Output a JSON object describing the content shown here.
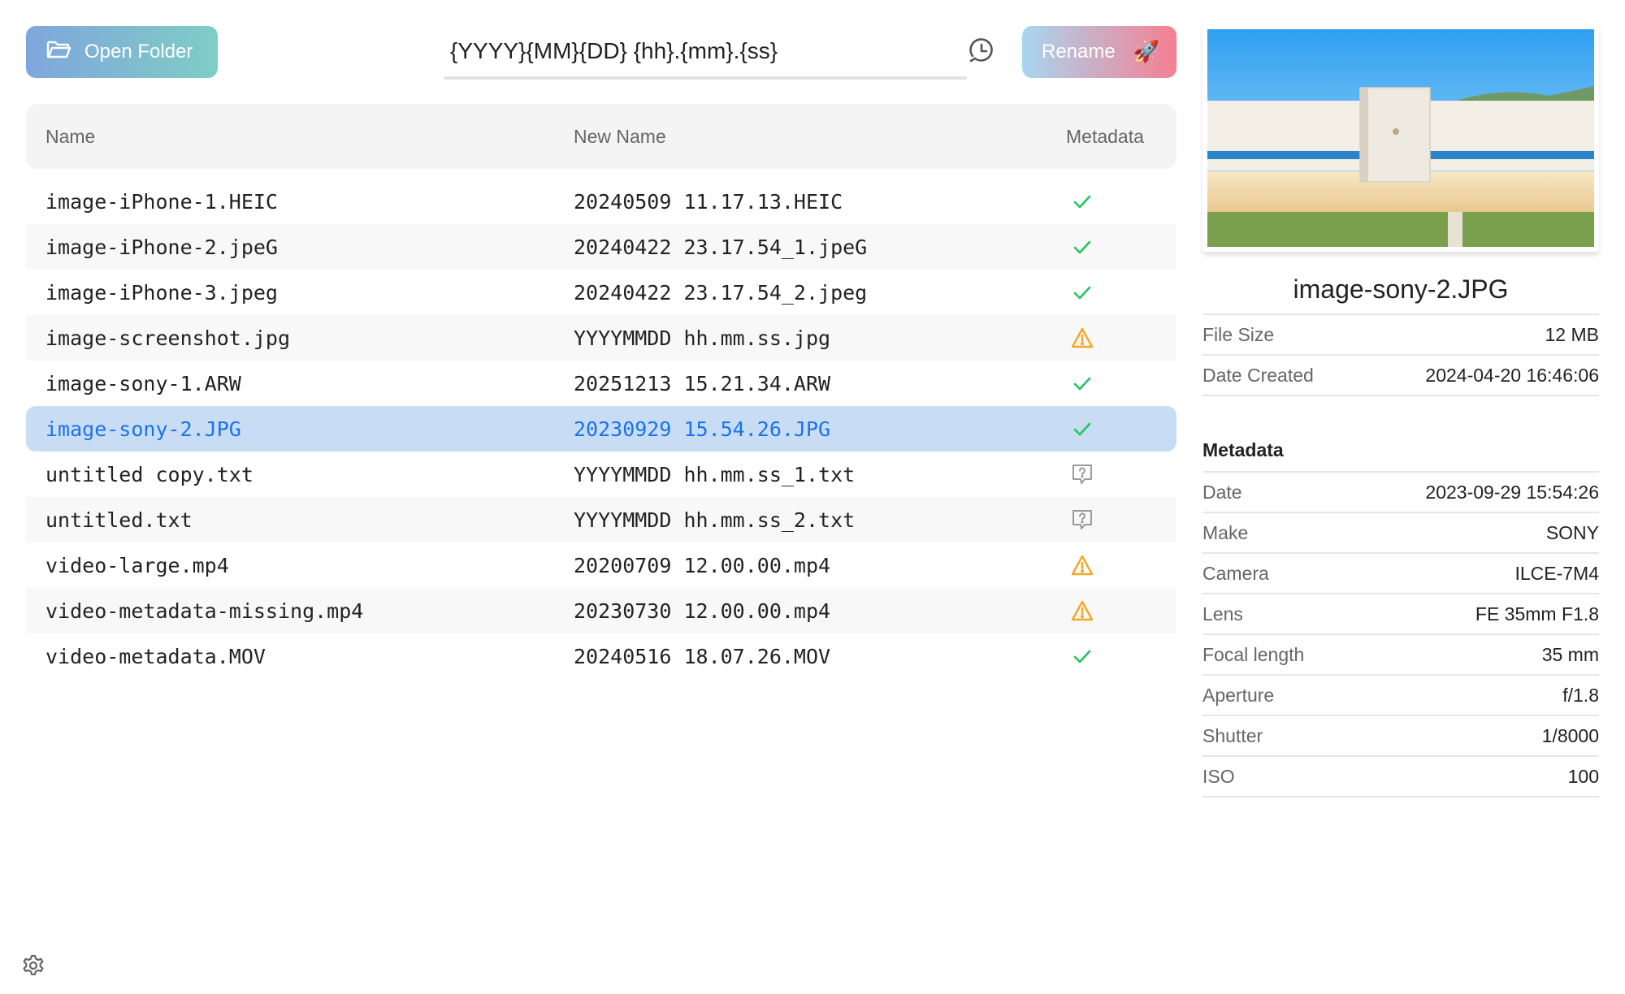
{
  "toolbar": {
    "open_folder_label": "Open Folder",
    "pattern_value": "{YYYY}{MM}{DD} {hh}.{mm}.{ss}",
    "rename_label": "Rename",
    "rename_emoji": "🚀"
  },
  "table": {
    "headers": {
      "name": "Name",
      "new_name": "New Name",
      "metadata": "Metadata"
    },
    "rows": [
      {
        "name": "image-iPhone-1.HEIC",
        "new_name": "20240509 11.17.13.HEIC",
        "status": "check"
      },
      {
        "name": "image-iPhone-2.jpeG",
        "new_name": "20240422 23.17.54_1.jpeG",
        "status": "check"
      },
      {
        "name": "image-iPhone-3.jpeg",
        "new_name": "20240422 23.17.54_2.jpeg",
        "status": "check"
      },
      {
        "name": "image-screenshot.jpg",
        "new_name": "YYYYMMDD hh.mm.ss.jpg",
        "status": "warning"
      },
      {
        "name": "image-sony-1.ARW",
        "new_name": "20251213 15.21.34.ARW",
        "status": "check"
      },
      {
        "name": "image-sony-2.JPG",
        "new_name": "20230929 15.54.26.JPG",
        "status": "check",
        "selected": true
      },
      {
        "name": "untitled copy.txt",
        "new_name": "YYYYMMDD hh.mm.ss_1.txt",
        "status": "unknown"
      },
      {
        "name": "untitled.txt",
        "new_name": "YYYYMMDD hh.mm.ss_2.txt",
        "status": "unknown"
      },
      {
        "name": "video-large.mp4",
        "new_name": "20200709 12.00.00.mp4",
        "status": "warning"
      },
      {
        "name": "video-metadata-missing.mp4",
        "new_name": "20230730 12.00.00.mp4",
        "status": "warning"
      },
      {
        "name": "video-metadata.MOV",
        "new_name": "20240516 18.07.26.MOV",
        "status": "check"
      }
    ]
  },
  "details": {
    "title": "image-sony-2.JPG",
    "file_info": [
      {
        "key": "File Size",
        "value": "12 MB"
      },
      {
        "key": "Date Created",
        "value": "2024-04-20 16:46:06"
      }
    ],
    "metadata_title": "Metadata",
    "metadata": [
      {
        "key": "Date",
        "value": "2023-09-29 15:54:26"
      },
      {
        "key": "Make",
        "value": "SONY"
      },
      {
        "key": "Camera",
        "value": "ILCE-7M4"
      },
      {
        "key": "Lens",
        "value": "FE 35mm F1.8"
      },
      {
        "key": "Focal length",
        "value": "35 mm"
      },
      {
        "key": "Aperture",
        "value": "f/1.8"
      },
      {
        "key": "Shutter",
        "value": "1/8000"
      },
      {
        "key": "ISO",
        "value": "100"
      }
    ]
  },
  "icons": {
    "open_folder": "folder-open-icon",
    "history": "history-clock-icon",
    "rename": "rocket-icon",
    "settings": "gear-icon",
    "status_check": "checkmark-icon",
    "status_warning": "warning-triangle-icon",
    "status_unknown": "question-bubble-icon"
  },
  "colors": {
    "check": "#22c55e",
    "warning": "#f5a623",
    "unknown": "#9a9a9a",
    "selected_row_bg": "#c8dcf4",
    "selected_row_text": "#1a73e8"
  }
}
